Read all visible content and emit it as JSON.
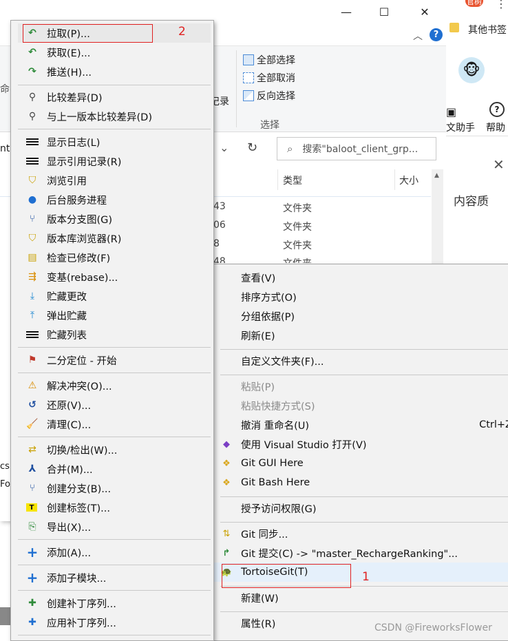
{
  "explorer": {
    "ribbon": {
      "select_all": "全部选择",
      "select_none": "全部取消",
      "invert_selection": "反向选择",
      "select_group": "选择",
      "record_partial": "记录",
      "name_partial": "命名"
    },
    "search_placeholder": "搜索\"baloot_client_grp...",
    "address_partial": "nt",
    "columns": {
      "type": "类型",
      "size": "大小"
    },
    "rows": [
      {
        "name_partial": "43",
        "type": "文件夹"
      },
      {
        "name_partial": "06",
        "type": "文件夹"
      },
      {
        "name_partial": "8",
        "type": "文件夹"
      },
      {
        "name_partial": "48",
        "type": "文件夹"
      }
    ],
    "left_partial": [
      "cs",
      "Fo"
    ]
  },
  "browser": {
    "avatar_name_partial": "官树",
    "bookmarks_label": "其他书签",
    "help_assistant": "文助手",
    "help": "帮助",
    "content_quality": "内容质",
    "watermark": "CSDN @FireworksFlower"
  },
  "left_menu": {
    "groups": [
      [
        {
          "label": "拉取(P)...",
          "icon": "pull-icon"
        },
        {
          "label": "获取(E)...",
          "icon": "fetch-icon"
        },
        {
          "label": "推送(H)...",
          "icon": "push-icon"
        }
      ],
      [
        {
          "label": "比较差异(D)",
          "icon": "diff-icon"
        },
        {
          "label": "与上一版本比较差异(D)",
          "icon": "diff-prev-icon"
        }
      ],
      [
        {
          "label": "显示日志(L)",
          "icon": "log-icon"
        },
        {
          "label": "显示引用记录(R)",
          "icon": "reflog-icon"
        },
        {
          "label": "浏览引用",
          "icon": "browse-refs-icon"
        },
        {
          "label": "后台服务进程",
          "icon": "daemon-icon"
        },
        {
          "label": "版本分支图(G)",
          "icon": "revision-graph-icon"
        },
        {
          "label": "版本库浏览器(R)",
          "icon": "repo-browser-icon"
        },
        {
          "label": "检查已修改(F)",
          "icon": "check-modifications-icon"
        },
        {
          "label": "变基(rebase)...",
          "icon": "rebase-icon"
        },
        {
          "label": "贮藏更改",
          "icon": "stash-save-icon"
        },
        {
          "label": "弹出贮藏",
          "icon": "stash-pop-icon"
        },
        {
          "label": "贮藏列表",
          "icon": "stash-list-icon"
        }
      ],
      [
        {
          "label": "二分定位 - 开始",
          "icon": "bisect-icon"
        }
      ],
      [
        {
          "label": "解决冲突(O)...",
          "icon": "resolve-icon"
        },
        {
          "label": "还原(V)...",
          "icon": "revert-icon"
        },
        {
          "label": "清理(C)...",
          "icon": "cleanup-icon"
        }
      ],
      [
        {
          "label": "切换/检出(W)...",
          "icon": "switch-checkout-icon"
        },
        {
          "label": "合并(M)...",
          "icon": "merge-icon"
        },
        {
          "label": "创建分支(B)...",
          "icon": "branch-icon"
        },
        {
          "label": "创建标签(T)...",
          "icon": "tag-icon"
        },
        {
          "label": "导出(X)...",
          "icon": "export-icon"
        }
      ],
      [
        {
          "label": "添加(A)...",
          "icon": "add-icon"
        }
      ],
      [
        {
          "label": "添加子模块...",
          "icon": "add-submodule-icon"
        }
      ],
      [
        {
          "label": "创建补丁序列...",
          "icon": "create-patch-icon"
        },
        {
          "label": "应用补丁序列...",
          "icon": "apply-patch-icon"
        }
      ]
    ]
  },
  "right_menu": {
    "items": [
      {
        "label": "查看(V)"
      },
      {
        "label": "排序方式(O)"
      },
      {
        "label": "分组依据(P)"
      },
      {
        "label": "刷新(E)"
      },
      {
        "label": "自定义文件夹(F)..."
      },
      {
        "label": "粘贴(P)"
      },
      {
        "label": "粘贴快捷方式(S)"
      },
      {
        "label": "撤消 重命名(U)",
        "shortcut": "Ctrl+Z"
      },
      {
        "label": "使用 Visual Studio 打开(V)"
      },
      {
        "label": "Git GUI Here"
      },
      {
        "label": "Git Bash Here"
      },
      {
        "label": "授予访问权限(G)"
      },
      {
        "label": "Git 同步..."
      },
      {
        "label": "Git 提交(C) -> \"master_RechargeRanking\"..."
      },
      {
        "label": "TortoiseGit(T)"
      },
      {
        "label": "新建(W)"
      },
      {
        "label": "属性(R)"
      }
    ]
  },
  "annotations": {
    "marker1": "1",
    "marker2": "2"
  }
}
